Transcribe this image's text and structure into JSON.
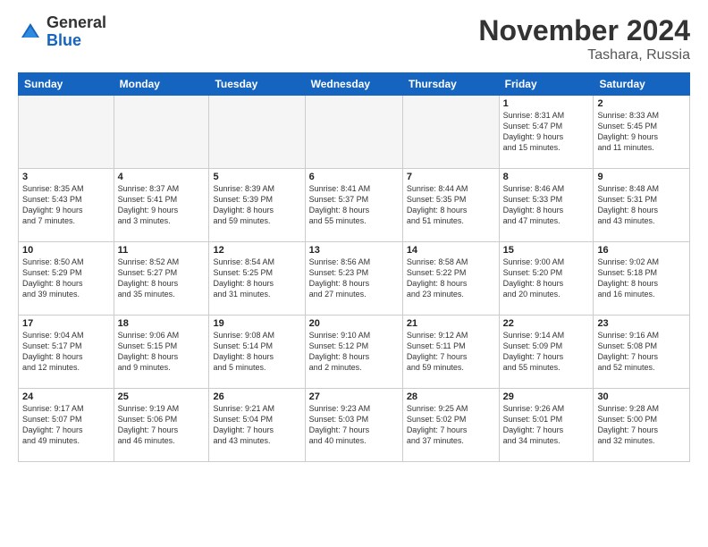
{
  "logo": {
    "general": "General",
    "blue": "Blue"
  },
  "header": {
    "month": "November 2024",
    "location": "Tashara, Russia"
  },
  "weekdays": [
    "Sunday",
    "Monday",
    "Tuesday",
    "Wednesday",
    "Thursday",
    "Friday",
    "Saturday"
  ],
  "weeks": [
    [
      {
        "day": "",
        "info": ""
      },
      {
        "day": "",
        "info": ""
      },
      {
        "day": "",
        "info": ""
      },
      {
        "day": "",
        "info": ""
      },
      {
        "day": "",
        "info": ""
      },
      {
        "day": "1",
        "info": "Sunrise: 8:31 AM\nSunset: 5:47 PM\nDaylight: 9 hours\nand 15 minutes."
      },
      {
        "day": "2",
        "info": "Sunrise: 8:33 AM\nSunset: 5:45 PM\nDaylight: 9 hours\nand 11 minutes."
      }
    ],
    [
      {
        "day": "3",
        "info": "Sunrise: 8:35 AM\nSunset: 5:43 PM\nDaylight: 9 hours\nand 7 minutes."
      },
      {
        "day": "4",
        "info": "Sunrise: 8:37 AM\nSunset: 5:41 PM\nDaylight: 9 hours\nand 3 minutes."
      },
      {
        "day": "5",
        "info": "Sunrise: 8:39 AM\nSunset: 5:39 PM\nDaylight: 8 hours\nand 59 minutes."
      },
      {
        "day": "6",
        "info": "Sunrise: 8:41 AM\nSunset: 5:37 PM\nDaylight: 8 hours\nand 55 minutes."
      },
      {
        "day": "7",
        "info": "Sunrise: 8:44 AM\nSunset: 5:35 PM\nDaylight: 8 hours\nand 51 minutes."
      },
      {
        "day": "8",
        "info": "Sunrise: 8:46 AM\nSunset: 5:33 PM\nDaylight: 8 hours\nand 47 minutes."
      },
      {
        "day": "9",
        "info": "Sunrise: 8:48 AM\nSunset: 5:31 PM\nDaylight: 8 hours\nand 43 minutes."
      }
    ],
    [
      {
        "day": "10",
        "info": "Sunrise: 8:50 AM\nSunset: 5:29 PM\nDaylight: 8 hours\nand 39 minutes."
      },
      {
        "day": "11",
        "info": "Sunrise: 8:52 AM\nSunset: 5:27 PM\nDaylight: 8 hours\nand 35 minutes."
      },
      {
        "day": "12",
        "info": "Sunrise: 8:54 AM\nSunset: 5:25 PM\nDaylight: 8 hours\nand 31 minutes."
      },
      {
        "day": "13",
        "info": "Sunrise: 8:56 AM\nSunset: 5:23 PM\nDaylight: 8 hours\nand 27 minutes."
      },
      {
        "day": "14",
        "info": "Sunrise: 8:58 AM\nSunset: 5:22 PM\nDaylight: 8 hours\nand 23 minutes."
      },
      {
        "day": "15",
        "info": "Sunrise: 9:00 AM\nSunset: 5:20 PM\nDaylight: 8 hours\nand 20 minutes."
      },
      {
        "day": "16",
        "info": "Sunrise: 9:02 AM\nSunset: 5:18 PM\nDaylight: 8 hours\nand 16 minutes."
      }
    ],
    [
      {
        "day": "17",
        "info": "Sunrise: 9:04 AM\nSunset: 5:17 PM\nDaylight: 8 hours\nand 12 minutes."
      },
      {
        "day": "18",
        "info": "Sunrise: 9:06 AM\nSunset: 5:15 PM\nDaylight: 8 hours\nand 9 minutes."
      },
      {
        "day": "19",
        "info": "Sunrise: 9:08 AM\nSunset: 5:14 PM\nDaylight: 8 hours\nand 5 minutes."
      },
      {
        "day": "20",
        "info": "Sunrise: 9:10 AM\nSunset: 5:12 PM\nDaylight: 8 hours\nand 2 minutes."
      },
      {
        "day": "21",
        "info": "Sunrise: 9:12 AM\nSunset: 5:11 PM\nDaylight: 7 hours\nand 59 minutes."
      },
      {
        "day": "22",
        "info": "Sunrise: 9:14 AM\nSunset: 5:09 PM\nDaylight: 7 hours\nand 55 minutes."
      },
      {
        "day": "23",
        "info": "Sunrise: 9:16 AM\nSunset: 5:08 PM\nDaylight: 7 hours\nand 52 minutes."
      }
    ],
    [
      {
        "day": "24",
        "info": "Sunrise: 9:17 AM\nSunset: 5:07 PM\nDaylight: 7 hours\nand 49 minutes."
      },
      {
        "day": "25",
        "info": "Sunrise: 9:19 AM\nSunset: 5:06 PM\nDaylight: 7 hours\nand 46 minutes."
      },
      {
        "day": "26",
        "info": "Sunrise: 9:21 AM\nSunset: 5:04 PM\nDaylight: 7 hours\nand 43 minutes."
      },
      {
        "day": "27",
        "info": "Sunrise: 9:23 AM\nSunset: 5:03 PM\nDaylight: 7 hours\nand 40 minutes."
      },
      {
        "day": "28",
        "info": "Sunrise: 9:25 AM\nSunset: 5:02 PM\nDaylight: 7 hours\nand 37 minutes."
      },
      {
        "day": "29",
        "info": "Sunrise: 9:26 AM\nSunset: 5:01 PM\nDaylight: 7 hours\nand 34 minutes."
      },
      {
        "day": "30",
        "info": "Sunrise: 9:28 AM\nSunset: 5:00 PM\nDaylight: 7 hours\nand 32 minutes."
      }
    ]
  ]
}
